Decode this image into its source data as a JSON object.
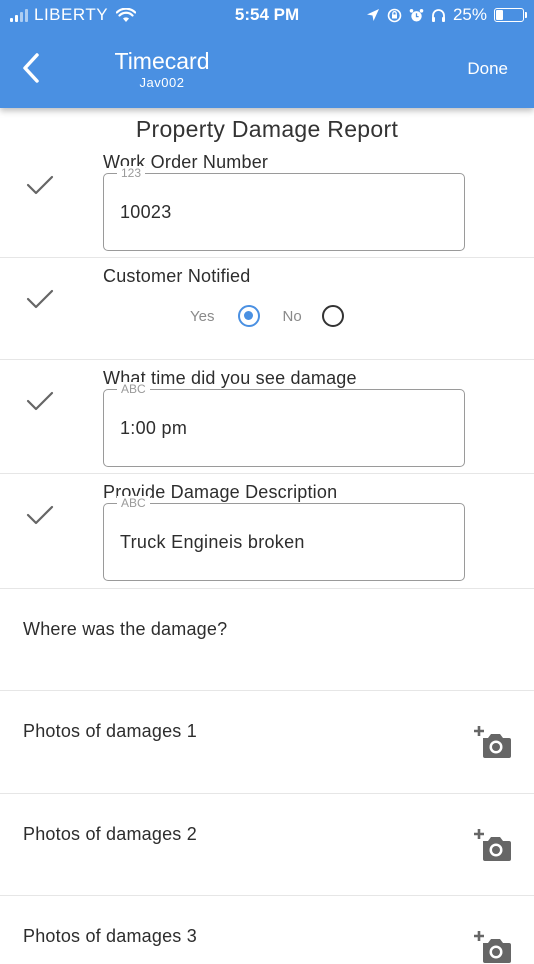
{
  "status_bar": {
    "carrier": "LIBERTY",
    "time": "5:54 PM",
    "battery_percent": "25%",
    "battery_level": 0.25
  },
  "header": {
    "back_icon": "chevron-left-icon",
    "title": "Timecard",
    "subtitle": "Jav002",
    "done_label": "Done",
    "color": "#4a90e2"
  },
  "form": {
    "title": "Property Damage Report",
    "fields": [
      {
        "label": "Work Order Number",
        "hint": "123",
        "value": "10023"
      },
      {
        "label": "Customer Notified",
        "options": [
          "Yes",
          "No"
        ],
        "selected": "Yes"
      },
      {
        "label": "What time did you see damage",
        "hint": "ABC",
        "value": "1:00 pm"
      },
      {
        "label": "Provide Damage Description",
        "hint": "ABC",
        "value": "Truck Engineis broken"
      }
    ],
    "location_label": "Where was the damage?",
    "photos": [
      {
        "label": "Photos of damages 1"
      },
      {
        "label": "Photos of damages 2"
      },
      {
        "label": "Photos of damages 3"
      }
    ]
  },
  "icons": {
    "check": "checkmark-icon",
    "camera": "add-photo-icon"
  }
}
